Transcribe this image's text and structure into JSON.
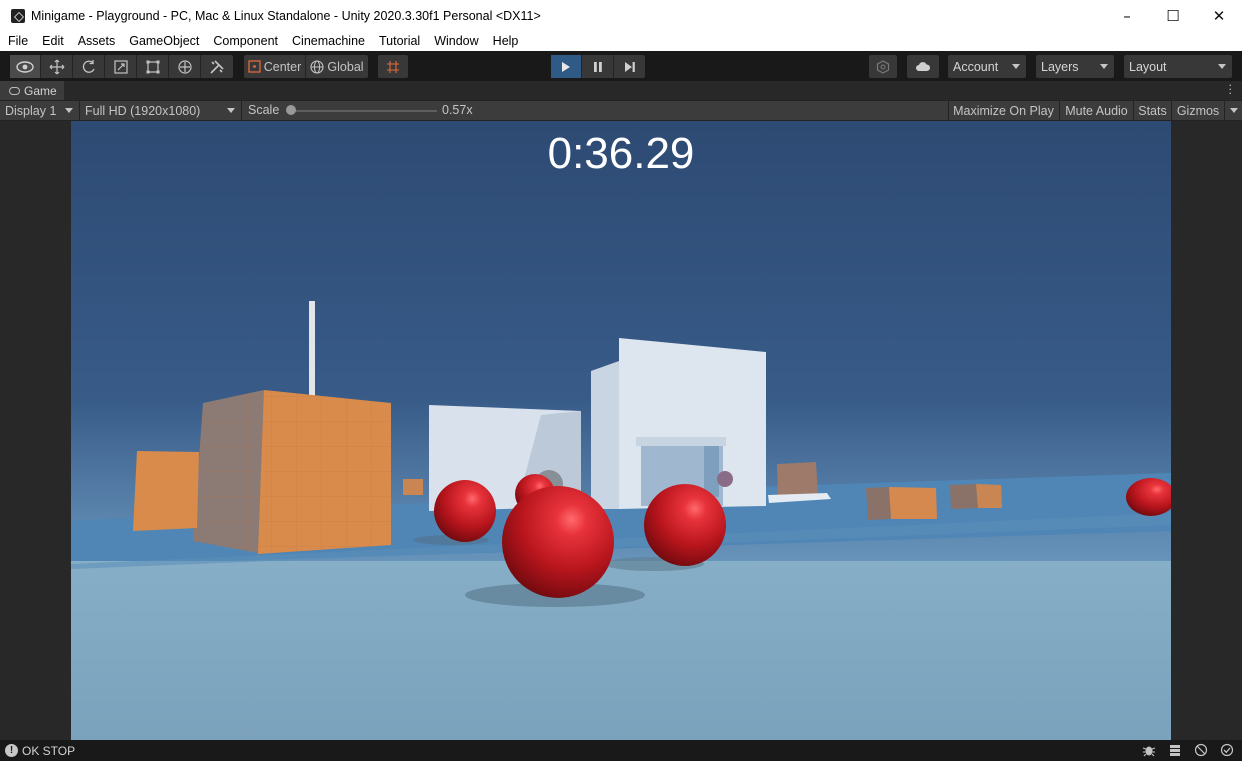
{
  "window": {
    "title": "Minigame - Playground - PC, Mac & Linux Standalone - Unity 2020.3.30f1 Personal <DX11>",
    "minimize": "–",
    "maximize": "☐",
    "close": "✕"
  },
  "menu": [
    "File",
    "Edit",
    "Assets",
    "GameObject",
    "Component",
    "Cinemachine",
    "Tutorial",
    "Window",
    "Help"
  ],
  "toolbar": {
    "pivot_label": "Center",
    "space_label": "Global",
    "account_label": "Account",
    "layers_label": "Layers",
    "layout_label": "Layout",
    "play_active": true
  },
  "tab": {
    "label": "Game"
  },
  "game_toolbar": {
    "display": "Display 1",
    "resolution": "Full HD (1920x1080)",
    "scale_label": "Scale",
    "scale_value": "0.57x",
    "maximize_on_play": "Maximize On Play",
    "mute_audio": "Mute Audio",
    "stats": "Stats",
    "gizmos": "Gizmos"
  },
  "game": {
    "timer": "0:36.29"
  },
  "status": {
    "message": "OK STOP"
  },
  "colors": {
    "sky_top": "#2f4f78",
    "sky_bottom": "#6f9bbf",
    "ground": "#7fa6c0",
    "ball": "#c01c24",
    "crate": "#d9894a",
    "play_accent": "#2f5a85"
  }
}
